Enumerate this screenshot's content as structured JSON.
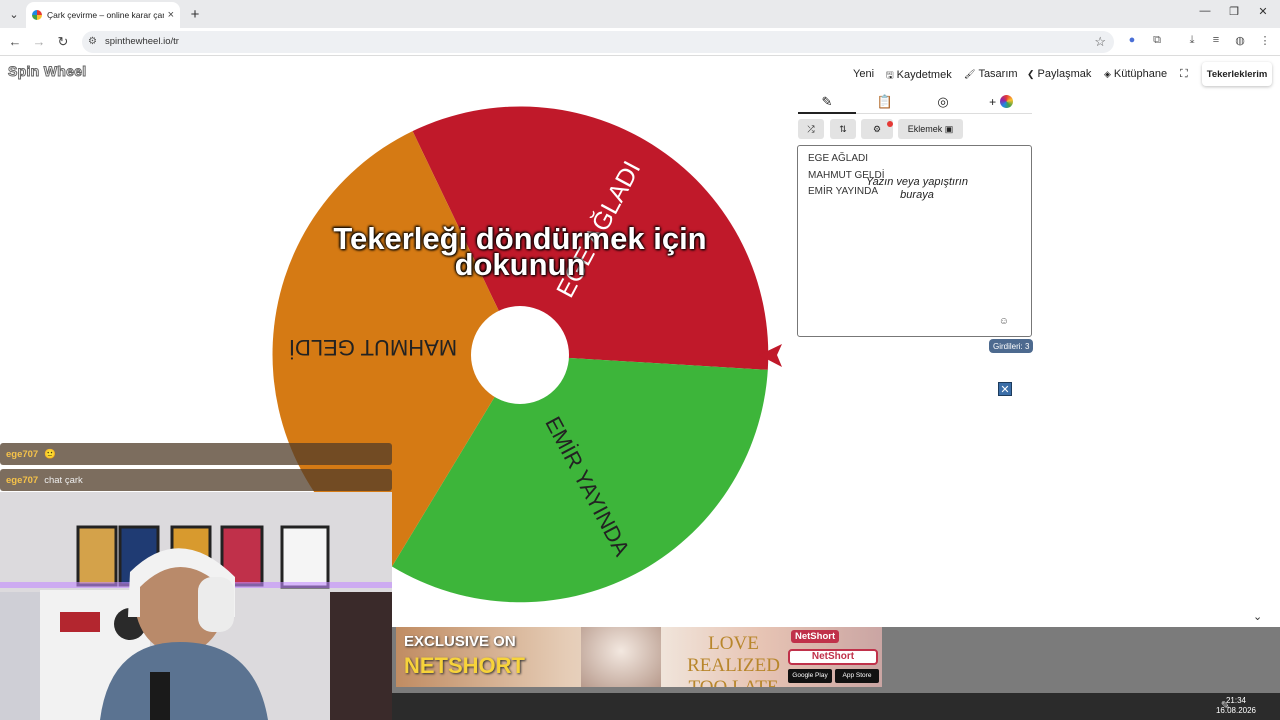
{
  "browser": {
    "tab_title": "Çark çevirme – online karar çarkı",
    "url": "spinthewheel.io/tr",
    "close_glyph": "×",
    "newtab_glyph": "+"
  },
  "site": {
    "logo": "Spin Wheel",
    "nav": [
      {
        "label": "Yeni",
        "icon": ""
      },
      {
        "label": "Kaydetmek",
        "icon": "save-icon"
      },
      {
        "label": "Tasarım",
        "icon": "paint-icon"
      },
      {
        "label": "Paylaşmak",
        "icon": "share-icon"
      },
      {
        "label": "Kütüphane",
        "icon": "layers-icon"
      }
    ],
    "my_wheels": "Tekerleklerim"
  },
  "wheel": {
    "spin_prompt": "Tekerleği döndürmek için dokunun",
    "segments": [
      {
        "label": "EGE AĞLADI",
        "color": "#c0192a"
      },
      {
        "label": "MAHMUT GELDİ",
        "color": "#d57a14"
      },
      {
        "label": "EMİR YAYINDA",
        "color": "#3db53a"
      }
    ],
    "pointer_color": "#c0192a"
  },
  "panel": {
    "add_button": "Eklemek",
    "entries": [
      "EGE AĞLADI",
      "MAHMUT GELDİ",
      "EMİR YAYINDA"
    ],
    "placeholder": "Yazın veya yapıştırın buraya",
    "count_label": "Girdileri: 3"
  },
  "stream": {
    "chat": [
      {
        "user": "ege707",
        "message": "🙂"
      },
      {
        "user": "ege707",
        "message": "chat çark"
      }
    ]
  },
  "ad": {
    "line1": "EXCLUSIVE ON",
    "line2": "NETSHORT",
    "title": "LOVE REALIZED TOO LATE",
    "brand": "NetShort",
    "store1": "Google Play",
    "store2": "App Store"
  },
  "taskbar": {
    "time": "21:34",
    "date": "16.08.2026"
  }
}
